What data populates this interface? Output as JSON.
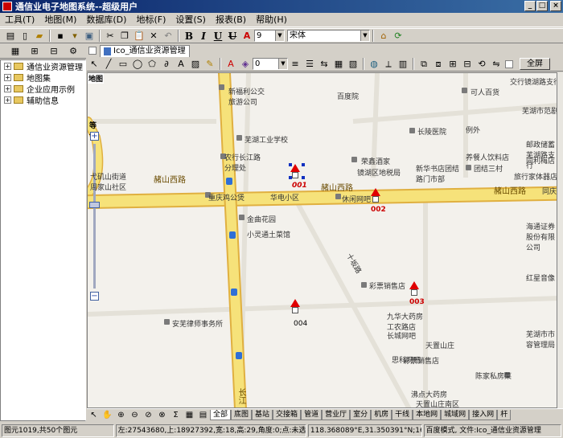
{
  "window": {
    "title": "通信业电子地图系统--超级用户",
    "controls": [
      "_",
      "□",
      "×"
    ]
  },
  "menu": [
    "工具(T)",
    "地图(M)",
    "数据库(D)",
    "地标(F)",
    "设置(S)",
    "报表(B)",
    "帮助(H)"
  ],
  "toolbar1": {
    "icons": [
      "layers-icon",
      "new-icon",
      "open-icon",
      "save-icon",
      "lock-icon",
      "print-icon",
      "cut-icon",
      "copy-icon",
      "paste-icon",
      "delete-icon",
      "undo-icon"
    ],
    "format": [
      "B",
      "I",
      "U",
      "U"
    ],
    "font_size": "9",
    "font_name": "宋体",
    "right_icons": [
      "home-icon",
      "refresh-icon"
    ]
  },
  "left": {
    "tree": [
      {
        "label": "通信业资源管理"
      },
      {
        "label": "地图集"
      },
      {
        "label": "企业应用示例"
      },
      {
        "label": "辅助信息"
      }
    ]
  },
  "doc_tab": "Ico_通信业资源管理",
  "toolbar2": {
    "line_width": "0",
    "fullscreen_label": "全屏"
  },
  "map": {
    "panel_label": "地图",
    "zoom_label": "等切",
    "zoom_level": 0.42,
    "roads": [
      {
        "name": "赭山西路",
        "label": "赭山西路"
      },
      {
        "name": "赭山西路2",
        "label": "赭山西路"
      },
      {
        "name": "赭山西路3",
        "label": "赭山西路"
      },
      {
        "name": "长江",
        "label": "长江"
      },
      {
        "name": "十坂路",
        "label": "十坂路"
      }
    ],
    "places": [
      "新福利公交旅游公司",
      "芜湖工业学校",
      "农行长江路分理处",
      "重庆鸡公煲",
      "华电小区",
      "金曲花园",
      "小灵通土菜馆",
      "荣鑫酒家",
      "镜湖区地税局",
      "休闲网吧",
      "彩票销售店",
      "九华大药房工农路店",
      "长城网吧",
      "思科网吧",
      "天置山庄",
      "彩票销售店",
      "沸点大药房",
      "天置山庄南区",
      "百度院",
      "安芜律师事务所",
      "弋矶山街道周家山社区",
      "长陵医院",
      "新华书店团结路门市部",
      "团结三村",
      "养餐人饮料店",
      "可人百货",
      "交行镜湖路支行",
      "芜湖市范剧小",
      "例外",
      "邮政储蓄芜湖路支行",
      "同利梅店",
      "旅行家体器店",
      "同庆",
      "海通证券股份有限公司",
      "红星音像",
      "芜湖市市容管理局",
      "陈家私房菜"
    ],
    "markers": [
      {
        "id": "001",
        "label": "001"
      },
      {
        "id": "002",
        "label": "002"
      },
      {
        "id": "003",
        "label": "003"
      },
      {
        "id": "004",
        "label": "004"
      }
    ]
  },
  "layer_tabs": [
    "全部",
    "底图",
    "基站",
    "交接箱",
    "管道",
    "营业厅",
    "室分",
    "机房",
    "干线",
    "本地网",
    "城域网",
    "接入网",
    "杆"
  ],
  "status": {
    "elements": "图元1019,共50个图元",
    "coords": "左:27543680,上:18927392,宽:18,高:29,角度:0;点:未选中",
    "latlon": "118.368089°E,31.350391°N;16级",
    "mode": "百度模式, 文件:Ico_通信业资源管理"
  },
  "colors": {
    "title_start": "#0a246a",
    "title_end": "#3a6ea5",
    "marker": "#e00000",
    "road_yellow": "#f6e27a",
    "road_border": "#e0b040"
  }
}
